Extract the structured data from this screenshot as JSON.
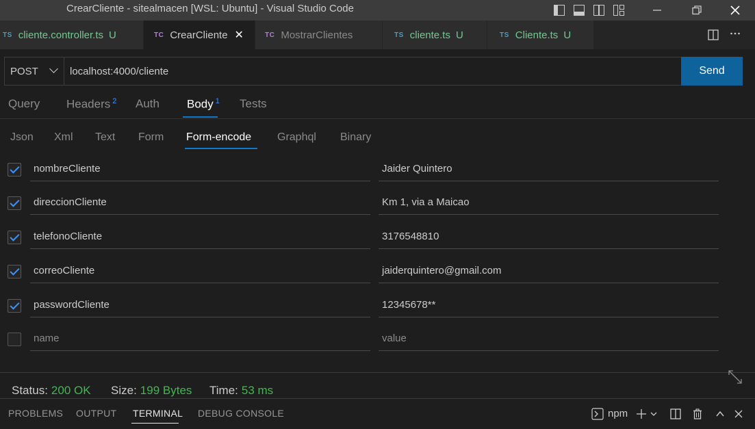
{
  "window": {
    "title": "CrearCliente - sitealmacen [WSL: Ubuntu] - Visual Studio Code"
  },
  "tabs": [
    {
      "badge": "TS",
      "label": "cliente.controller.ts",
      "status": "U"
    },
    {
      "badge": "TC",
      "label": "CrearCliente",
      "close": "✕"
    },
    {
      "badge": "TC",
      "label": "MostrarClientes"
    },
    {
      "badge": "TS",
      "label": "cliente.ts",
      "status": "U"
    },
    {
      "badge": "TS",
      "label": "Cliente.ts",
      "status": "U"
    }
  ],
  "request": {
    "method": "POST",
    "url": "localhost:4000/cliente",
    "send_label": "Send"
  },
  "request_tabs": {
    "query": "Query",
    "headers": "Headers",
    "headers_count": "2",
    "auth": "Auth",
    "body": "Body",
    "body_count": "1",
    "tests": "Tests"
  },
  "body_tabs": {
    "json": "Json",
    "xml": "Xml",
    "text": "Text",
    "form": "Form",
    "form_encode": "Form-encode",
    "graphql": "Graphql",
    "binary": "Binary"
  },
  "form_rows": [
    {
      "checked": true,
      "key": "nombreCliente",
      "value": "Jaider Quintero"
    },
    {
      "checked": true,
      "key": "direccionCliente",
      "value": "Km 1, via a Maicao"
    },
    {
      "checked": true,
      "key": "telefonoCliente",
      "value": "3176548810"
    },
    {
      "checked": true,
      "key": "correoCliente",
      "value": "jaiderquintero@gmail.com"
    },
    {
      "checked": true,
      "key": "passwordCliente",
      "value": "12345678**"
    },
    {
      "checked": false,
      "key_placeholder": "name",
      "value_placeholder": "value"
    }
  ],
  "response": {
    "status_label": "Status:",
    "status_value": "200 OK",
    "size_label": "Size:",
    "size_value": "199 Bytes",
    "time_label": "Time:",
    "time_value": "53 ms"
  },
  "panel": {
    "problems": "PROBLEMS",
    "output": "OUTPUT",
    "terminal": "TERMINAL",
    "debug_console": "DEBUG CONSOLE",
    "terminal_name": "npm"
  },
  "colors": {
    "accent": "#0e639c",
    "success": "#3fb950",
    "untracked": "#73c991"
  }
}
